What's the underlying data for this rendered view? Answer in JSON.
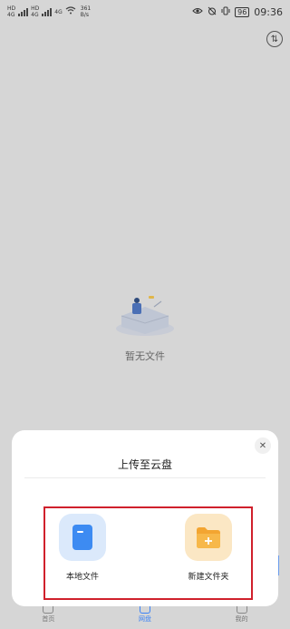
{
  "status_bar": {
    "sim1": [
      "HD",
      "4G"
    ],
    "sim2": [
      "HD",
      "4G"
    ],
    "net_badge": "4G",
    "speed_value": "361",
    "speed_unit": "B/s",
    "battery": "96",
    "time": "09:36"
  },
  "empty_state": {
    "text": "暂无文件"
  },
  "bottom_nav": {
    "items": [
      {
        "label": "首页"
      },
      {
        "label": "网盘"
      },
      {
        "label": "我的"
      }
    ],
    "active": "网盘"
  },
  "upload_sheet": {
    "title": "上传至云盘",
    "options": [
      {
        "label": "本地文件",
        "icon": "document-icon"
      },
      {
        "label": "新建文件夹",
        "icon": "folder-plus-icon"
      }
    ]
  },
  "colors": {
    "accent": "#3b82f6",
    "highlight_frame": "#d0202c",
    "dim_background": "#d6d6d6"
  }
}
